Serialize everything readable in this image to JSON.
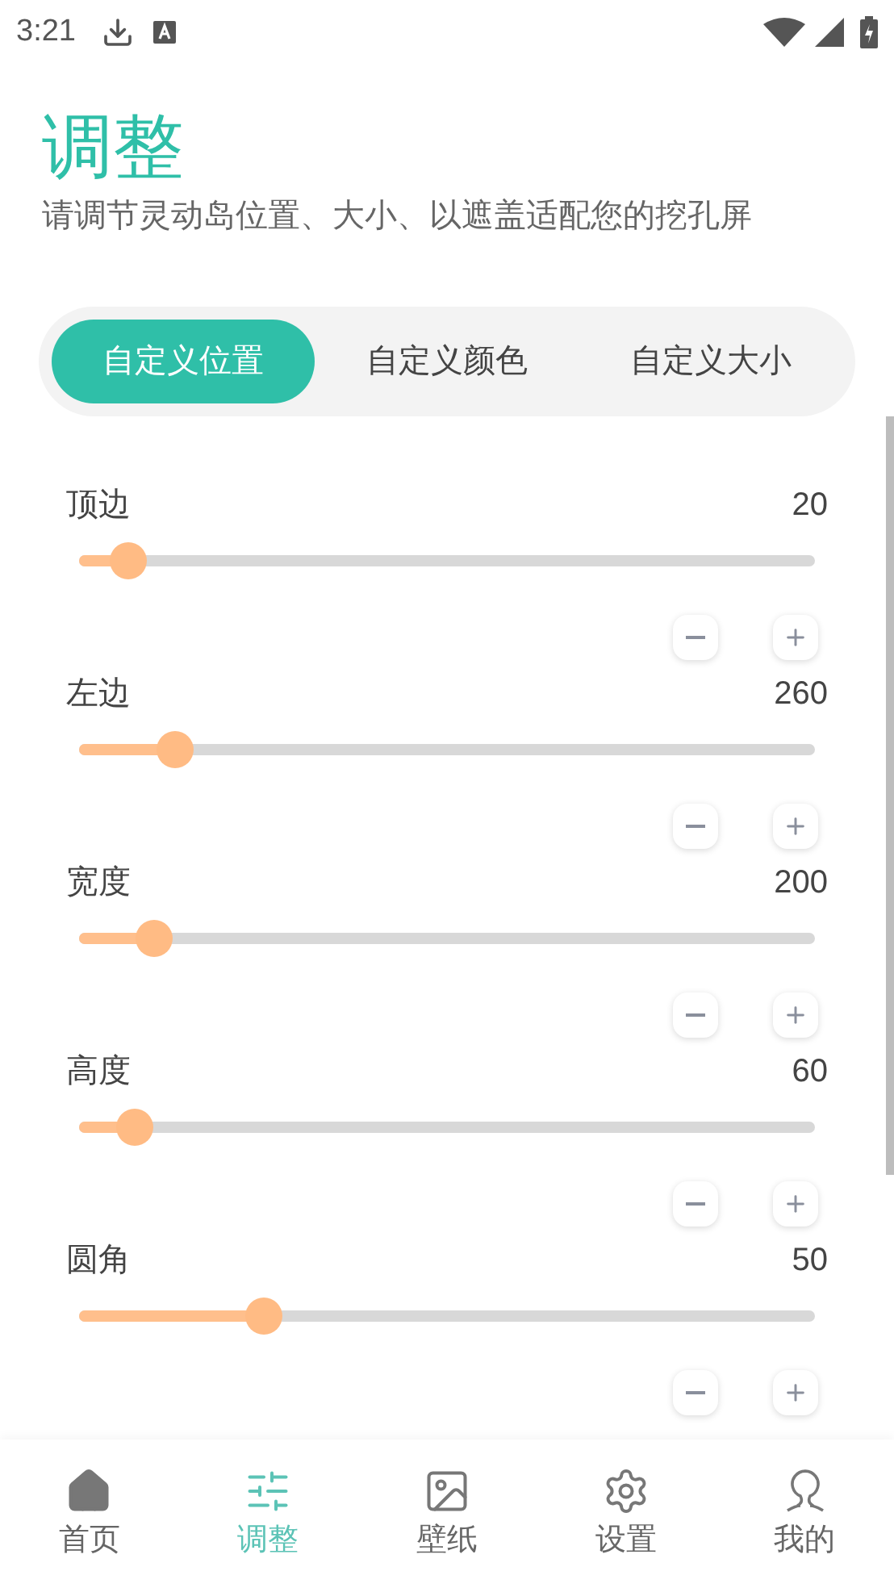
{
  "status_bar": {
    "time": "3:21"
  },
  "header": {
    "title": "调整",
    "subtitle": "请调节灵动岛位置、大小、以遮盖适配您的挖孔屏"
  },
  "tabs": [
    {
      "label": "自定义位置",
      "selected": true
    },
    {
      "label": "自定义颜色",
      "selected": false
    },
    {
      "label": "自定义大小",
      "selected": false
    }
  ],
  "sliders": [
    {
      "label": "顶边",
      "reading": "20",
      "level": 0.066
    },
    {
      "label": "左边",
      "reading": "260",
      "level": 0.13
    },
    {
      "label": "宽度",
      "reading": "200",
      "level": 0.1
    },
    {
      "label": "高度",
      "reading": "60",
      "level": 0.075
    },
    {
      "label": "圆角",
      "reading": "50",
      "level": 0.25
    }
  ],
  "bottom_nav": [
    {
      "kind": "home",
      "label": "首页",
      "selected": false
    },
    {
      "kind": "adjust",
      "label": "调整",
      "selected": true
    },
    {
      "kind": "wallpaper",
      "label": "壁纸",
      "selected": false
    },
    {
      "kind": "settings",
      "label": "设置",
      "selected": false
    },
    {
      "kind": "profile",
      "label": "我的",
      "selected": false
    }
  ]
}
